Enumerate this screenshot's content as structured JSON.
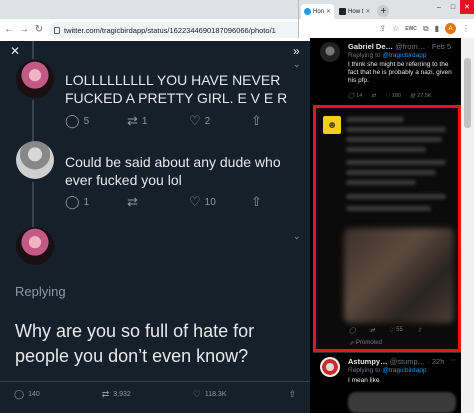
{
  "browser_left": {
    "url": "twitter.com/tragicbirdapp/status/1622344690187096066/photo/1"
  },
  "browser_right": {
    "tabs": [
      {
        "label": "Hon"
      },
      {
        "label": "How t"
      }
    ],
    "new_tab": "+",
    "ext_label": "EWC",
    "profile_initial": "A"
  },
  "thread": {
    "tweets": [
      {
        "text": "LOLLLLLLLLL YOU HAVE NEVER FUCKED A PRETTY GIRL. E V E R",
        "replies": "5",
        "retweets": "1",
        "likes": "2"
      },
      {
        "text": "Could be said about any dude who ever fucked you lol",
        "replies": "1",
        "retweets": "",
        "likes": "10"
      }
    ],
    "replying_label": "Replying",
    "main_text": "Why are you so full of hate for people you don’t even know?",
    "stats": {
      "replies": "140",
      "retweets": "3,932",
      "likes": "118.3K"
    }
  },
  "sidebar": {
    "tweet1": {
      "name": "Gabriel De…",
      "meta": "@from… · Feb 5",
      "replying_prefix": "Replying to",
      "replying_handle": "@tragicbirdapp",
      "text": "I think she might be referring to the fact that he is probably a nazi, given his pfp.",
      "replies": "14",
      "retweets": "",
      "likes": "180",
      "views": "27.5K"
    },
    "promo": {
      "replies": "",
      "retweets": "",
      "likes": "55",
      "promoted_label": "Promoted"
    },
    "tweet3": {
      "name": "Astumpy…",
      "meta": "@stump… · 22h",
      "replying_prefix": "Replying to",
      "replying_handle": "@tragicbirdapp",
      "text": "I mean like"
    }
  },
  "colors": {
    "highlight_box": "#e8141a",
    "twitter_blue": "#1d9bf0",
    "dim_background": "#15202b"
  }
}
